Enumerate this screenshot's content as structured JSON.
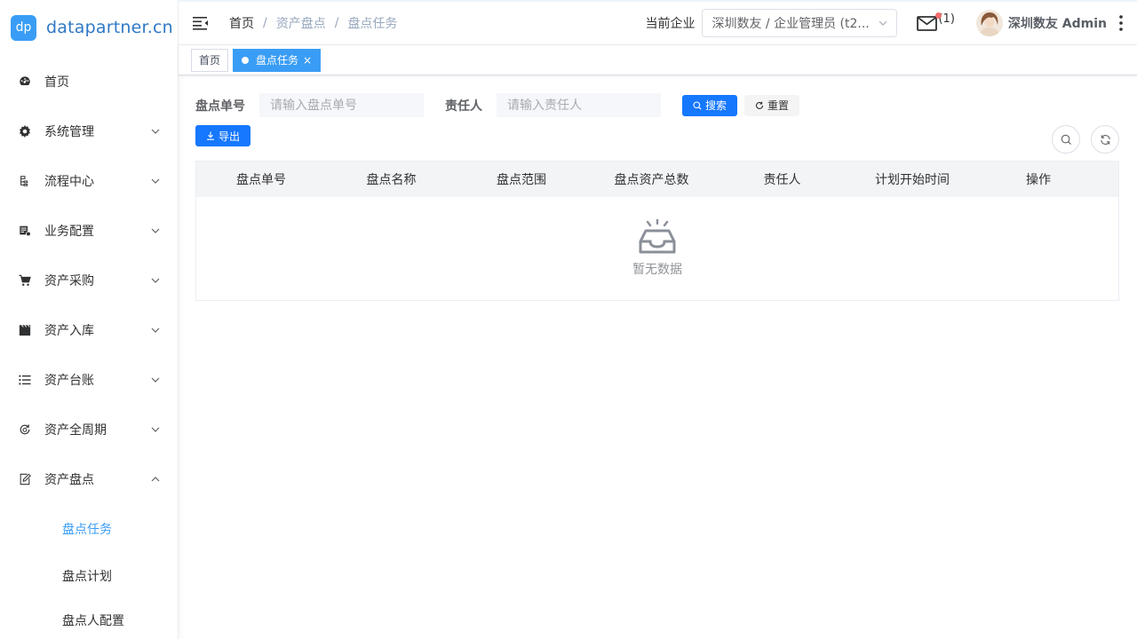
{
  "logo": {
    "badge": "dp",
    "text": "datapartner.cn"
  },
  "sidebar": {
    "items": [
      {
        "label": "首页",
        "icon": "dashboard-icon"
      },
      {
        "label": "系统管理",
        "icon": "gear-icon"
      },
      {
        "label": "流程中心",
        "icon": "flow-icon"
      },
      {
        "label": "业务配置",
        "icon": "config-icon"
      },
      {
        "label": "资产采购",
        "icon": "cart-icon"
      },
      {
        "label": "资产入库",
        "icon": "clapperboard-icon"
      },
      {
        "label": "资产台账",
        "icon": "list-icon"
      },
      {
        "label": "资产全周期",
        "icon": "cycle-icon"
      },
      {
        "label": "资产盘点",
        "icon": "edit-icon"
      }
    ],
    "sub_items": [
      {
        "label": "盘点任务"
      },
      {
        "label": "盘点计划"
      },
      {
        "label": "盘点人配置"
      }
    ]
  },
  "header": {
    "breadcrumb": [
      "首页",
      "资产盘点",
      "盘点任务"
    ],
    "breadcrumb_sep": "/",
    "enterprise_label": "当前企业",
    "enterprise_value": "深圳数友 / 企业管理员 (t2...",
    "mail_count": "(1)",
    "username": "深圳数友 Admin"
  },
  "tags": {
    "home": "首页",
    "active": "盘点任务",
    "close": "×"
  },
  "filter": {
    "order_label": "盘点单号",
    "order_placeholder": "请输入盘点单号",
    "owner_label": "责任人",
    "owner_placeholder": "请输入责任人",
    "search_label": "搜索",
    "reset_label": "重置",
    "export_label": "导出"
  },
  "table": {
    "columns": [
      "盘点单号",
      "盘点名称",
      "盘点范围",
      "盘点资产总数",
      "责任人",
      "计划开始时间",
      "操作"
    ],
    "empty_text": "暂无数据"
  },
  "colors": {
    "primary": "#1677ff",
    "accent": "#3a9df5",
    "badge_red": "#f56c6c"
  }
}
